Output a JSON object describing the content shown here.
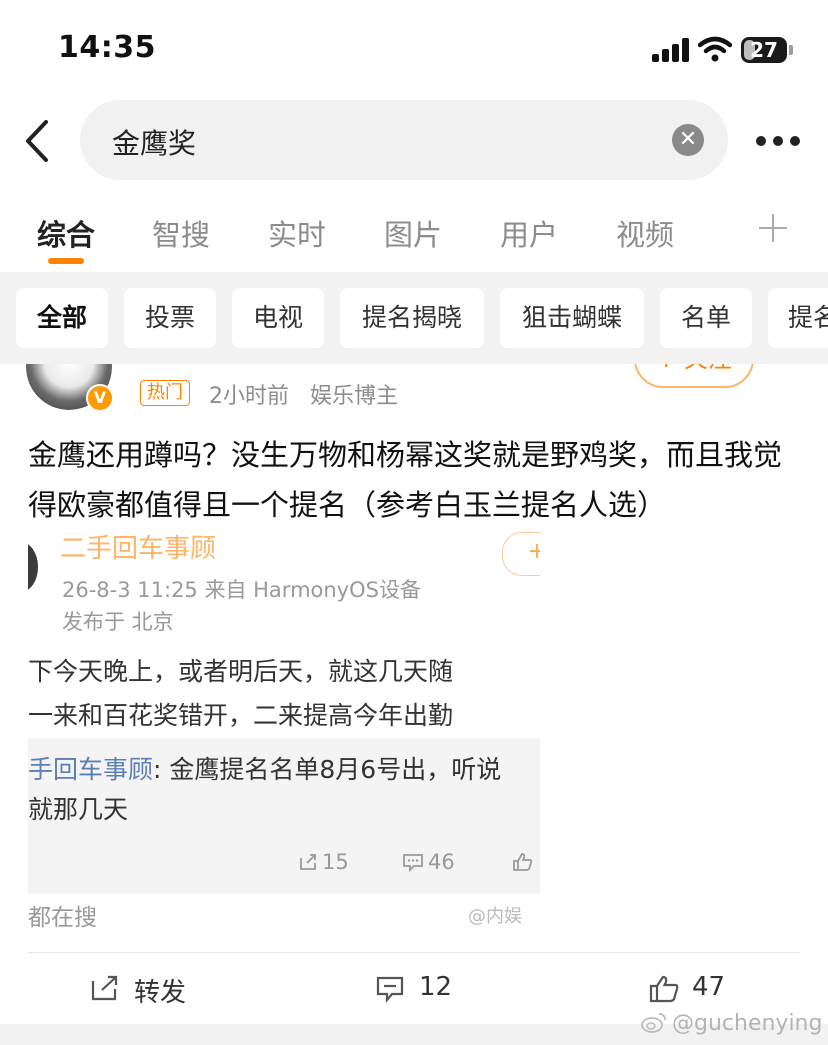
{
  "status_bar": {
    "time": "14:35",
    "battery": "27",
    "battery_level": 0.27
  },
  "search": {
    "query": "金鹰奖",
    "clear_icon": "clear-icon",
    "back_icon": "chevron-left-icon",
    "more_icon": "more-icon"
  },
  "tabs": [
    {
      "label": "综合",
      "active": true
    },
    {
      "label": "智搜"
    },
    {
      "label": "实时"
    },
    {
      "label": "图片"
    },
    {
      "label": "用户"
    },
    {
      "label": "视频"
    }
  ],
  "filters": [
    "全部",
    "投票",
    "电视",
    "提名揭晓",
    "狙击蝴蝶",
    "名单",
    "提名"
  ],
  "post": {
    "follow_label": "+ 关注",
    "hot_tag": "热门",
    "time": "2小时前",
    "source": "娱乐博主",
    "text": "金鹰还用蹲吗？没生万物和杨幂这奖就是野鸡奖，而且我觉得欧豪都值得且一个提名（参考白玉兰提名人选）"
  },
  "embed": {
    "author": "二手回车事顾",
    "follow": "+",
    "meta": "26-8-3 11:25  来自 HarmonyOS设备",
    "location": "发布于 北京",
    "body_line1": "下今天晚上，或者明后天，就这几天随",
    "body_line2": "一来和百花奖错开，二来提高今年出勤",
    "quote_name": "手回车事顾",
    "quote_text": ": 金鹰提名名单8月6号出，听说",
    "quote_line2": "就那几天",
    "reposts": "15",
    "comments": "46",
    "footer_left": "都在搜",
    "footer_right": "@内娱"
  },
  "actions": {
    "repost_label": "转发",
    "comment_count": "12",
    "like_count": "47"
  },
  "watermark": "@guchenying",
  "colors": {
    "accent": "#ff8200",
    "link": "#5b7fb4",
    "muted": "#8c8c8c"
  }
}
